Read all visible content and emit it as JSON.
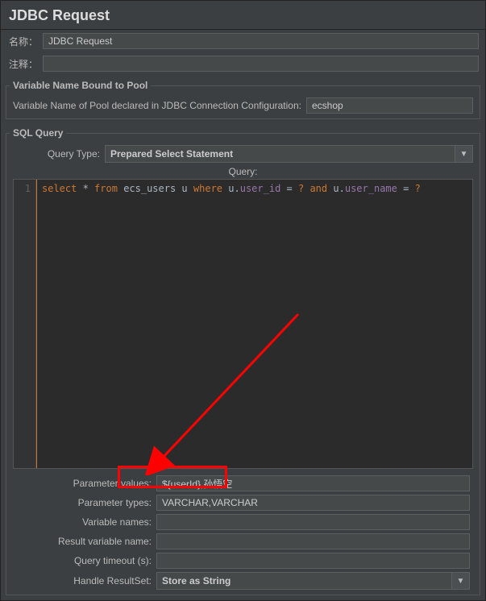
{
  "title": "JDBC Request",
  "name_label": "名称：",
  "name_value": "JDBC Request",
  "comment_label": "注释：",
  "comment_value": "",
  "pool_section_title": "Variable Name Bound to Pool",
  "pool_label": "Variable Name of Pool declared in JDBC Connection Configuration:",
  "pool_value": "ecshop",
  "sql_section_title": "SQL Query",
  "query_type_label": "Query Type:",
  "query_type_value": "Prepared Select Statement",
  "query_header": "Query:",
  "gutter_line1": "1",
  "sql": {
    "select": "select",
    "star": " * ",
    "from": "from",
    "sp1": " ",
    "table": "ecs_users u ",
    "where": "where",
    "sp2": " ",
    "alias1": "u",
    "dot1": ".",
    "col1": "user_id",
    "eq1": " = ",
    "q1": "?",
    "sp3": " ",
    "and": "and",
    "sp4": " ",
    "alias2": "u",
    "dot2": ".",
    "col2": "user_name",
    "eq2": " = ",
    "q2": "?"
  },
  "params": {
    "values_label": "Parameter values:",
    "values_value": "${userId},孙悟空",
    "types_label": "Parameter types:",
    "types_value": "VARCHAR,VARCHAR",
    "varnames_label": "Variable names:",
    "varnames_value": "",
    "resultvar_label": "Result variable name:",
    "resultvar_value": "",
    "timeout_label": "Query timeout (s):",
    "timeout_value": "",
    "handle_label": "Handle ResultSet:",
    "handle_value": "Store as String"
  }
}
